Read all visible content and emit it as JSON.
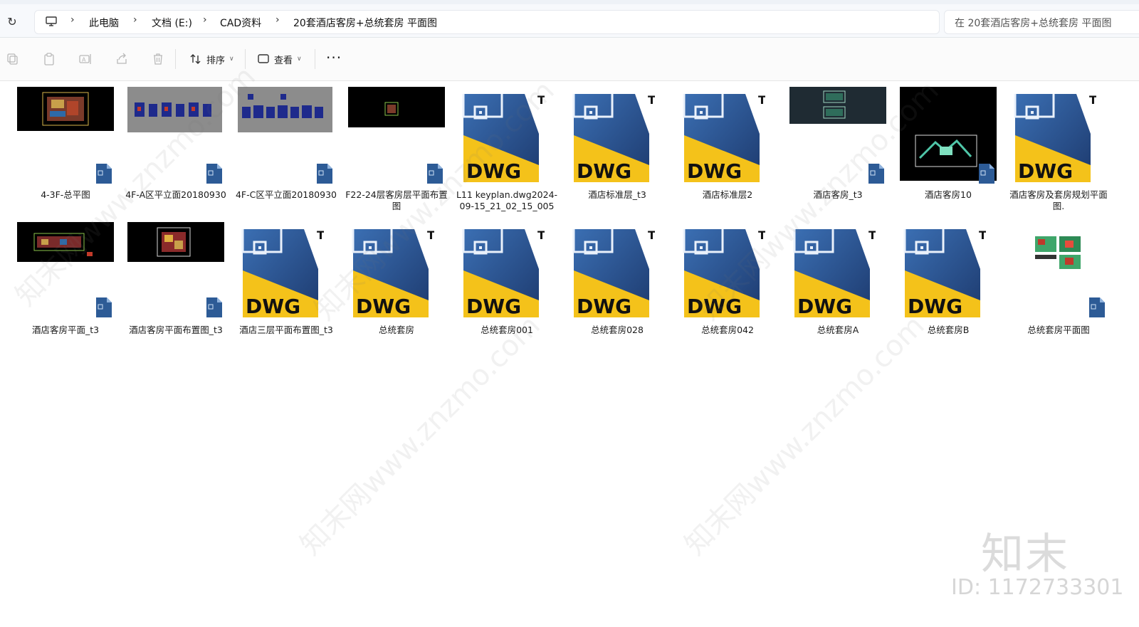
{
  "addressbar": {
    "breadcrumb": [
      "此电脑",
      "文档 (E:)",
      "CAD资料",
      "20套酒店客房+总统套房 平面图"
    ],
    "search_placeholder": "在 20套酒店客房+总统套房 平面图"
  },
  "toolbar": {
    "sort_label": "排序",
    "view_label": "查看",
    "more_label": "···"
  },
  "files": {
    "row1": [
      {
        "name": "4-3F-总平图",
        "kind": "thumb-black"
      },
      {
        "name": "4F-A区平立面20180930",
        "kind": "thumb-gray"
      },
      {
        "name": "4F-C区平立面20180930",
        "kind": "thumb-gray"
      },
      {
        "name": "F22-24层客房层平面布置图",
        "kind": "thumb-black"
      },
      {
        "name": "L11 keyplan.dwg2024-09-15_21_02_15_005",
        "kind": "dwg"
      },
      {
        "name": "酒店标准层_t3",
        "kind": "dwg"
      },
      {
        "name": "酒店标准层2",
        "kind": "dwg"
      },
      {
        "name": "酒店客房_t3",
        "kind": "thumb-dark"
      },
      {
        "name": "酒店客房10",
        "kind": "thumb-black-tall"
      },
      {
        "name": "酒店客房及套房规划平面图.",
        "kind": "dwg"
      }
    ],
    "row2": [
      {
        "name": "酒店客房平面_t3",
        "kind": "thumb-black"
      },
      {
        "name": "酒店客房平面布置图_t3",
        "kind": "thumb-black"
      },
      {
        "name": "酒店三层平面布置图_t3",
        "kind": "dwg"
      },
      {
        "name": "总统套房",
        "kind": "dwg"
      },
      {
        "name": "总统套房001",
        "kind": "dwg"
      },
      {
        "name": "总统套房028",
        "kind": "dwg"
      },
      {
        "name": "总统套房042",
        "kind": "dwg"
      },
      {
        "name": "总统套房A",
        "kind": "dwg"
      },
      {
        "name": "总统套房B",
        "kind": "dwg"
      },
      {
        "name": "总统套房平面图",
        "kind": "thumb-white"
      }
    ],
    "dwg_badge": "DWG",
    "dwg_tm": "TM"
  },
  "watermark": {
    "logo": "知末",
    "id": "ID: 1172733301",
    "site": "知末网www.znzmo.com"
  }
}
